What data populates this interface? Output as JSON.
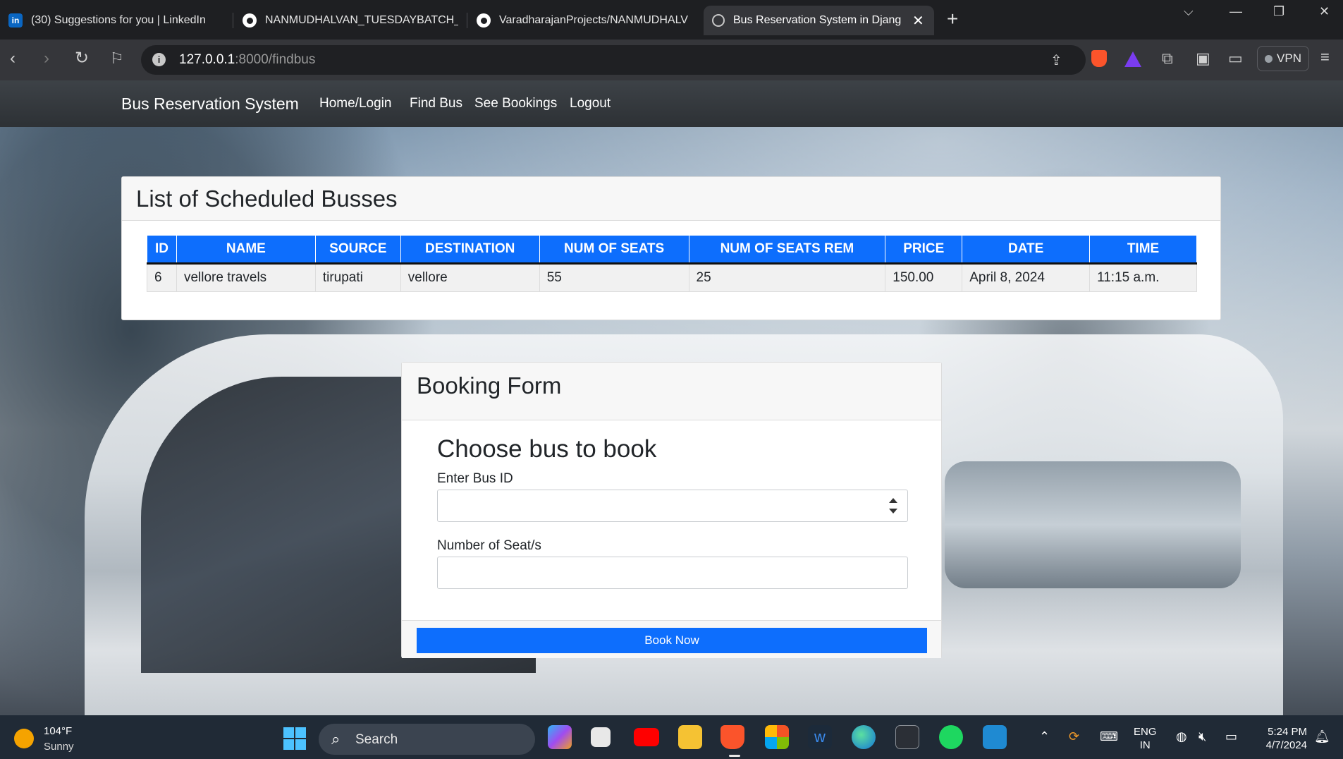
{
  "browser": {
    "tabs": [
      {
        "title": "(30) Suggestions for you | LinkedIn",
        "icon": "linkedin-icon"
      },
      {
        "title": "NANMUDHALVAN_TUESDAYBATCH_",
        "icon": "github-icon"
      },
      {
        "title": "VaradharajanProjects/NANMUDHALV",
        "icon": "github-icon"
      },
      {
        "title": "Bus Reservation System in Djang",
        "icon": "globe-icon",
        "active": true
      }
    ],
    "url_host": "127.0.0.1",
    "url_path": ":8000/findbus",
    "vpn_label": "VPN"
  },
  "site": {
    "brand": "Bus Reservation System",
    "nav": [
      "Home/Login",
      "Find Bus",
      "See Bookings",
      "Logout"
    ]
  },
  "list": {
    "title": "List of Scheduled Busses",
    "columns": [
      "ID",
      "NAME",
      "SOURCE",
      "DESTINATION",
      "NUM OF SEATS",
      "NUM OF SEATS REM",
      "PRICE",
      "DATE",
      "TIME"
    ],
    "rows": [
      [
        "6",
        "vellore travels",
        "tirupati",
        "vellore",
        "55",
        "25",
        "150.00",
        "April 8, 2024",
        "11:15 a.m."
      ]
    ]
  },
  "form": {
    "header": "Booking Form",
    "heading": "Choose bus to book",
    "bus_id_label": "Enter Bus ID",
    "bus_id_value": "",
    "seats_label": "Number of Seat/s",
    "seats_value": "",
    "submit_label": "Book Now"
  },
  "taskbar": {
    "temperature": "104°F",
    "condition": "Sunny",
    "search_label": "Search",
    "lang_primary": "ENG",
    "lang_secondary": "IN",
    "time": "5:24 PM",
    "date": "4/7/2024"
  },
  "colors": {
    "primary": "#0d6efd",
    "navbar": "#343a40",
    "taskbar": "#202a36"
  }
}
